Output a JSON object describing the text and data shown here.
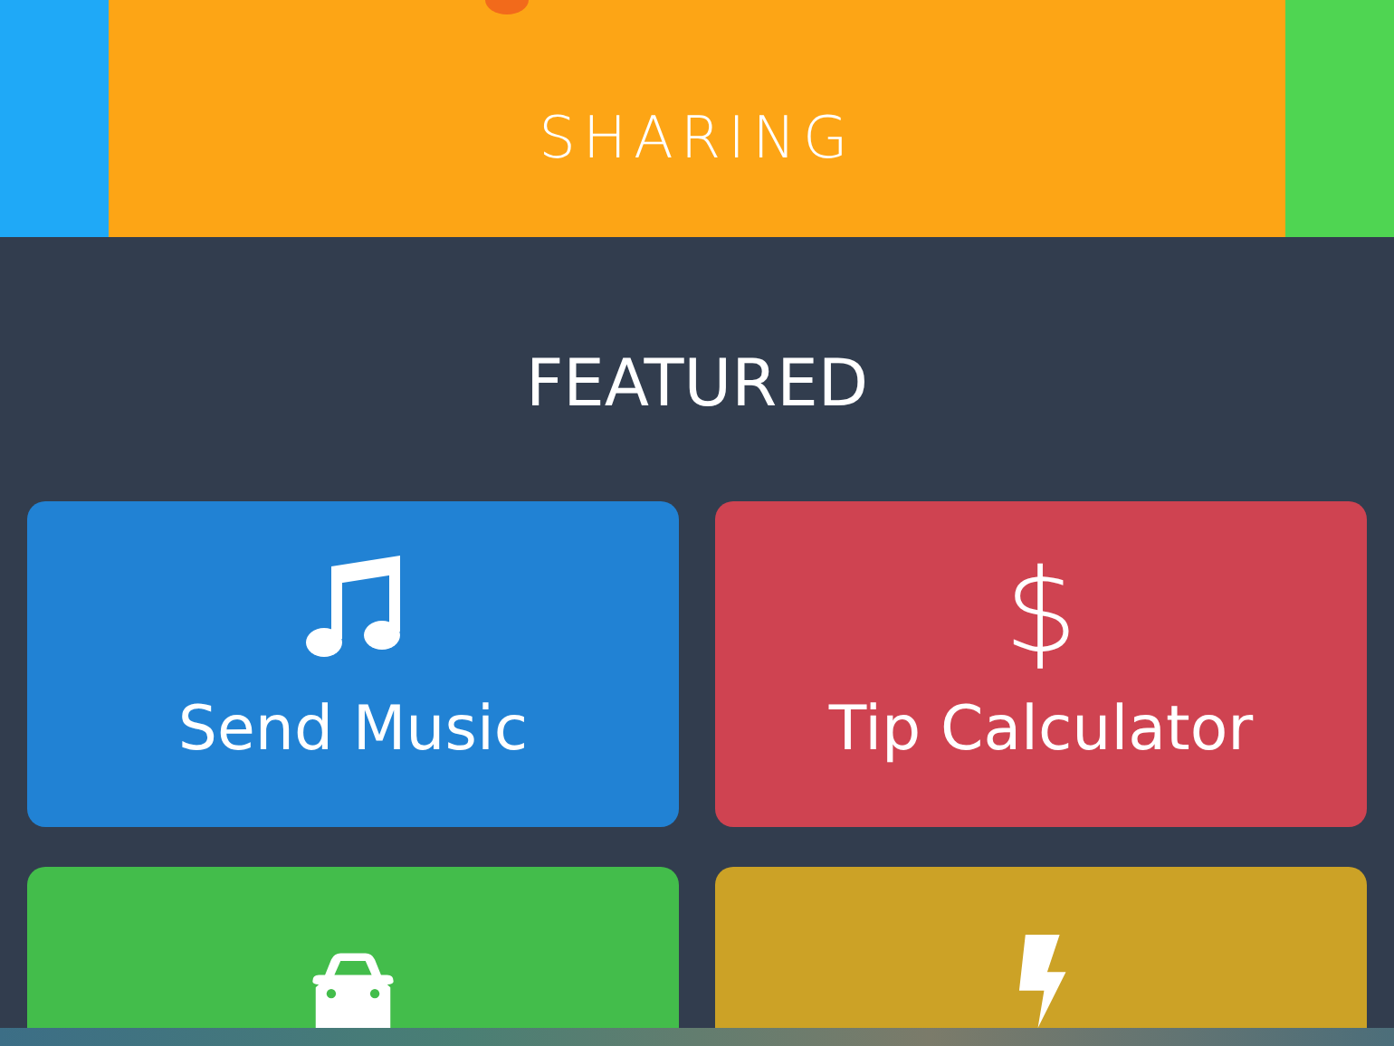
{
  "carousel": [
    {
      "color": "#1fa9f7",
      "selected": false
    },
    {
      "label": "SHARING",
      "color": "#fda515",
      "selected": true
    },
    {
      "color": "#4fd552",
      "selected": false
    }
  ],
  "section": {
    "title": "FEATURED"
  },
  "tiles": [
    {
      "kind": "music",
      "label": "Send Music",
      "color": "#2182d4"
    },
    {
      "kind": "symbol",
      "symbol": "$",
      "label": "Tip Calculator",
      "color": "#cf4351"
    },
    {
      "kind": "car",
      "color": "#43bd4b"
    },
    {
      "kind": "bolt",
      "color": "#cca226"
    }
  ]
}
